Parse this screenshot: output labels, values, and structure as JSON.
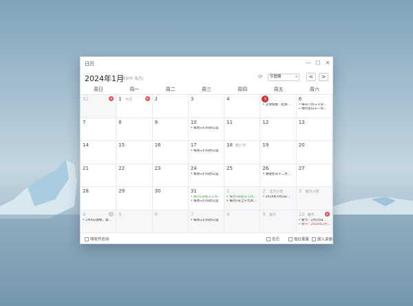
{
  "window": {
    "title": "日历"
  },
  "header": {
    "month_title": "2024年1月",
    "lunar_year": "(癸卯年 兔月)",
    "holiday_select": "节假期",
    "prev": "<",
    "next": ">"
  },
  "weekdays": [
    "周日",
    "周一",
    "周二",
    "周三",
    "周四",
    "周五",
    "周六"
  ],
  "cells": [
    {
      "day": "31",
      "other": true,
      "badge": "休"
    },
    {
      "day": "1",
      "lunar": "元旦",
      "badge": "休"
    },
    {
      "day": "2"
    },
    {
      "day": "3"
    },
    {
      "day": "4"
    },
    {
      "day": "5",
      "today": true,
      "events": [
        "又会提醒 - 起身…"
      ]
    },
    {
      "day": "6",
      "events": [
        "每天八点三十分…",
        "预约生日十一月…"
      ]
    },
    {
      "day": "7"
    },
    {
      "day": "8"
    },
    {
      "day": "9"
    },
    {
      "day": "10",
      "events": [
        "每周三打扫办公室"
      ]
    },
    {
      "day": "11"
    },
    {
      "day": "12"
    },
    {
      "day": "13"
    },
    {
      "day": "14"
    },
    {
      "day": "15"
    },
    {
      "day": "16"
    },
    {
      "day": "17",
      "events": [
        "每周三打扫办公室"
      ]
    },
    {
      "day": "18",
      "lunar": "腊八节"
    },
    {
      "day": "19"
    },
    {
      "day": "20"
    },
    {
      "day": "21"
    },
    {
      "day": "22"
    },
    {
      "day": "23"
    },
    {
      "day": "24",
      "events": [
        "每周三打扫办公室"
      ]
    },
    {
      "day": "25"
    },
    {
      "day": "26",
      "events": [
        "谁顺生日十二月…"
      ]
    },
    {
      "day": "27"
    },
    {
      "day": "28"
    },
    {
      "day": "29"
    },
    {
      "day": "30"
    },
    {
      "day": "31",
      "events": [
        "每月1号提交工作…",
        "每周三打扫办公室"
      ],
      "colors": [
        "green",
        ""
      ]
    },
    {
      "day": "1",
      "other": true,
      "events": [
        "每月1号提交工作…",
        "每月1号上午九点…"
      ],
      "colors": [
        "green",
        ""
      ]
    },
    {
      "day": "2",
      "other": true,
      "lunar": "北方小年",
      "events": [
        "2024年2月5日…"
      ]
    },
    {
      "day": "3",
      "other": true,
      "lunar": "南方小年"
    },
    {
      "day": "4",
      "other": true,
      "badge": "班",
      "badge_gray": true,
      "events": [
        "2月4日调休，需…"
      ]
    },
    {
      "day": "5",
      "other": true
    },
    {
      "day": "6",
      "other": true
    },
    {
      "day": "7",
      "other": true,
      "events": [
        "每周三打扫办公室"
      ]
    },
    {
      "day": "8",
      "other": true
    },
    {
      "day": "9",
      "other": true,
      "lunar": "除夕"
    },
    {
      "day": "10",
      "other": true,
      "lunar": "春节",
      "badge": "休",
      "events": [
        "春节：2月10日…",
        "春节：2024年2月…"
      ],
      "colors": [
        "",
        "red"
      ]
    }
  ],
  "footer": {
    "startup": "随软件启动",
    "lunar": "农历",
    "weekly_review": "每日重置",
    "embed_desktop": "嵌入桌面"
  }
}
